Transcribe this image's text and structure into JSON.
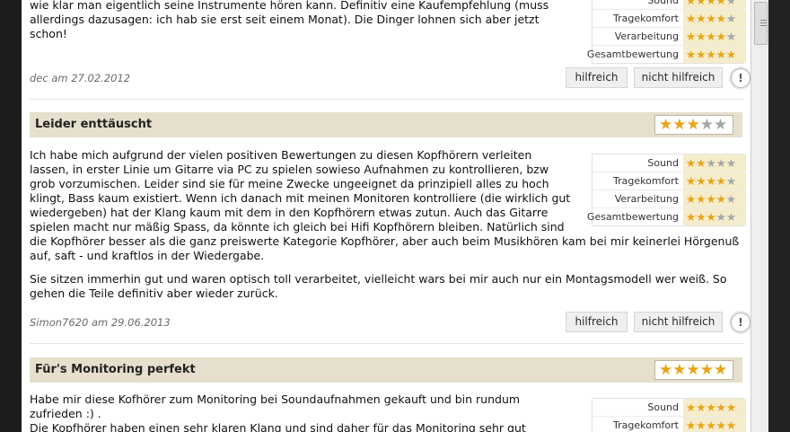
{
  "labels": {
    "sound": "Sound",
    "comfort": "Tragekomfort",
    "build": "Verarbeitung",
    "overall": "Gesamtbewertung",
    "helpful": "hilfreich",
    "not_helpful": "nicht hilfreich",
    "report": "!"
  },
  "colors": {
    "star_on": "#e8a417",
    "star_off": "#a6a6a6",
    "header_bg": "#e6dfcd",
    "rating_bg": "#f5eccb"
  },
  "review_top": {
    "text_lines": [
      "wie klar man eigentlich seine Instrumente hören kann. Definitiv eine Kaufempfehlung (muss",
      "allerdings dazusagen: ich hab sie erst seit einem Monat). Die Dinger lohnen sich aber jetzt",
      "schon!"
    ],
    "ratings": {
      "sound": 4,
      "comfort": 4,
      "build": 4,
      "overall": 5
    },
    "meta": "dec am 27.02.2012"
  },
  "review_2": {
    "title": "Leider enttäuscht",
    "stars": 3,
    "paragraph1_lines": [
      "Ich habe mich aufgrund der vielen positiven Bewertungen zu diesen Kopfhörern verleiten",
      "lassen, in erster Linie um Gitarre via PC zu spielen sowieso Aufnahmen zu kontrollieren, bzw",
      "grob vorzumischen. Leider sind sie für meine Zwecke ungeeignet da prinzipiell alles zu hoch",
      "klingt, Bass kaum existiert. Wenn ich danach mit meinen Monitoren kontrolliere (die wirklich gut",
      "wiedergeben) hat der Klang kaum mit dem in den Kopfhörern etwas zutun. Auch das Gitarre",
      "spielen macht nur mäßig Spass, da könnte ich gleich bei Hifi Kopfhörern bleiben. Natürlich sind",
      "die Kopfhörer besser als die ganz preiswerte Kategorie Kopfhörer, aber auch beim Musikhören kam bei mir keinerlei Hörgenuß",
      "auf, saft - und kraftlos in der Wiedergabe."
    ],
    "paragraph2_lines": [
      "Sie sitzen immerhin gut und waren optisch toll verarbeitet, vielleicht wars bei mir auch nur ein Montagsmodell wer weiß. So",
      "gehen die Teile definitiv aber wieder zurück."
    ],
    "ratings": {
      "sound": 2,
      "comfort": 4,
      "build": 4,
      "overall": 3
    },
    "meta": "Simon7620 am 29.06.2013"
  },
  "review_3": {
    "title": "Für's Monitoring perfekt",
    "stars": 5,
    "text_lines": [
      "Habe mir diese Kofhörer zum Monitoring bei Soundaufnahmen gekauft und bin rundum",
      "zufrieden :) .",
      "Die Kopfhörer haben einen sehr klaren Klang und sind daher für das Monitoring sehr gut"
    ],
    "ratings": {
      "sound": 5,
      "comfort": 5
    }
  }
}
